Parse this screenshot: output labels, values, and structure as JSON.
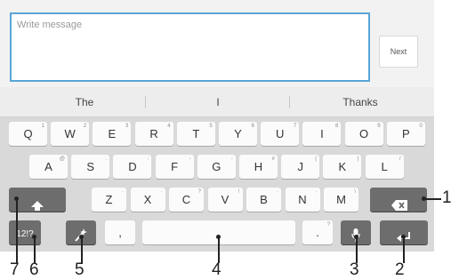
{
  "compose": {
    "placeholder": "Write message",
    "next_label": "Next"
  },
  "suggestions": [
    "The",
    "I",
    "Thanks"
  ],
  "rows": {
    "row1": [
      {
        "label": "Q",
        "alt": "1"
      },
      {
        "label": "W",
        "alt": "2"
      },
      {
        "label": "E",
        "alt": "3"
      },
      {
        "label": "R",
        "alt": "4"
      },
      {
        "label": "T",
        "alt": "5"
      },
      {
        "label": "Y",
        "alt": "6"
      },
      {
        "label": "U",
        "alt": "7"
      },
      {
        "label": "I",
        "alt": "8"
      },
      {
        "label": "O",
        "alt": "9"
      },
      {
        "label": "P",
        "alt": "0"
      }
    ],
    "row2": [
      {
        "label": "A",
        "alt": "@"
      },
      {
        "label": "S",
        "alt": "."
      },
      {
        "label": "D",
        "alt": ":"
      },
      {
        "label": "F",
        "alt": "-"
      },
      {
        "label": "G",
        "alt": "-"
      },
      {
        "label": "H",
        "alt": "#"
      },
      {
        "label": "J",
        "alt": "("
      },
      {
        "label": "K",
        "alt": ")"
      },
      {
        "label": "L",
        "alt": "/"
      }
    ],
    "row3": [
      {
        "label": "Z",
        "alt": "·"
      },
      {
        "label": "X",
        "alt": "·"
      },
      {
        "label": "C",
        "alt": "?"
      },
      {
        "label": "V",
        "alt": "!"
      },
      {
        "label": "B",
        "alt": "·"
      },
      {
        "label": "N",
        "alt": "·"
      },
      {
        "label": "M",
        "alt": "\\"
      }
    ]
  },
  "bottom_row": {
    "symbols_label": "12!?",
    "comma_label": ",",
    "period_label": ".",
    "period_alt": "?"
  },
  "icons": {
    "shift": "shift-arrow-up-icon",
    "backspace": "backspace-icon",
    "settings": "magic-wand-settings-icon",
    "mic": "microphone-icon",
    "enter": "enter-return-icon"
  },
  "callouts": [
    "1",
    "2",
    "3",
    "4",
    "5",
    "6",
    "7"
  ],
  "colors": {
    "field_border": "#5aa6d6",
    "keyboard_bg": "#d9d9d9",
    "dark_key": "#6d6d6d"
  }
}
